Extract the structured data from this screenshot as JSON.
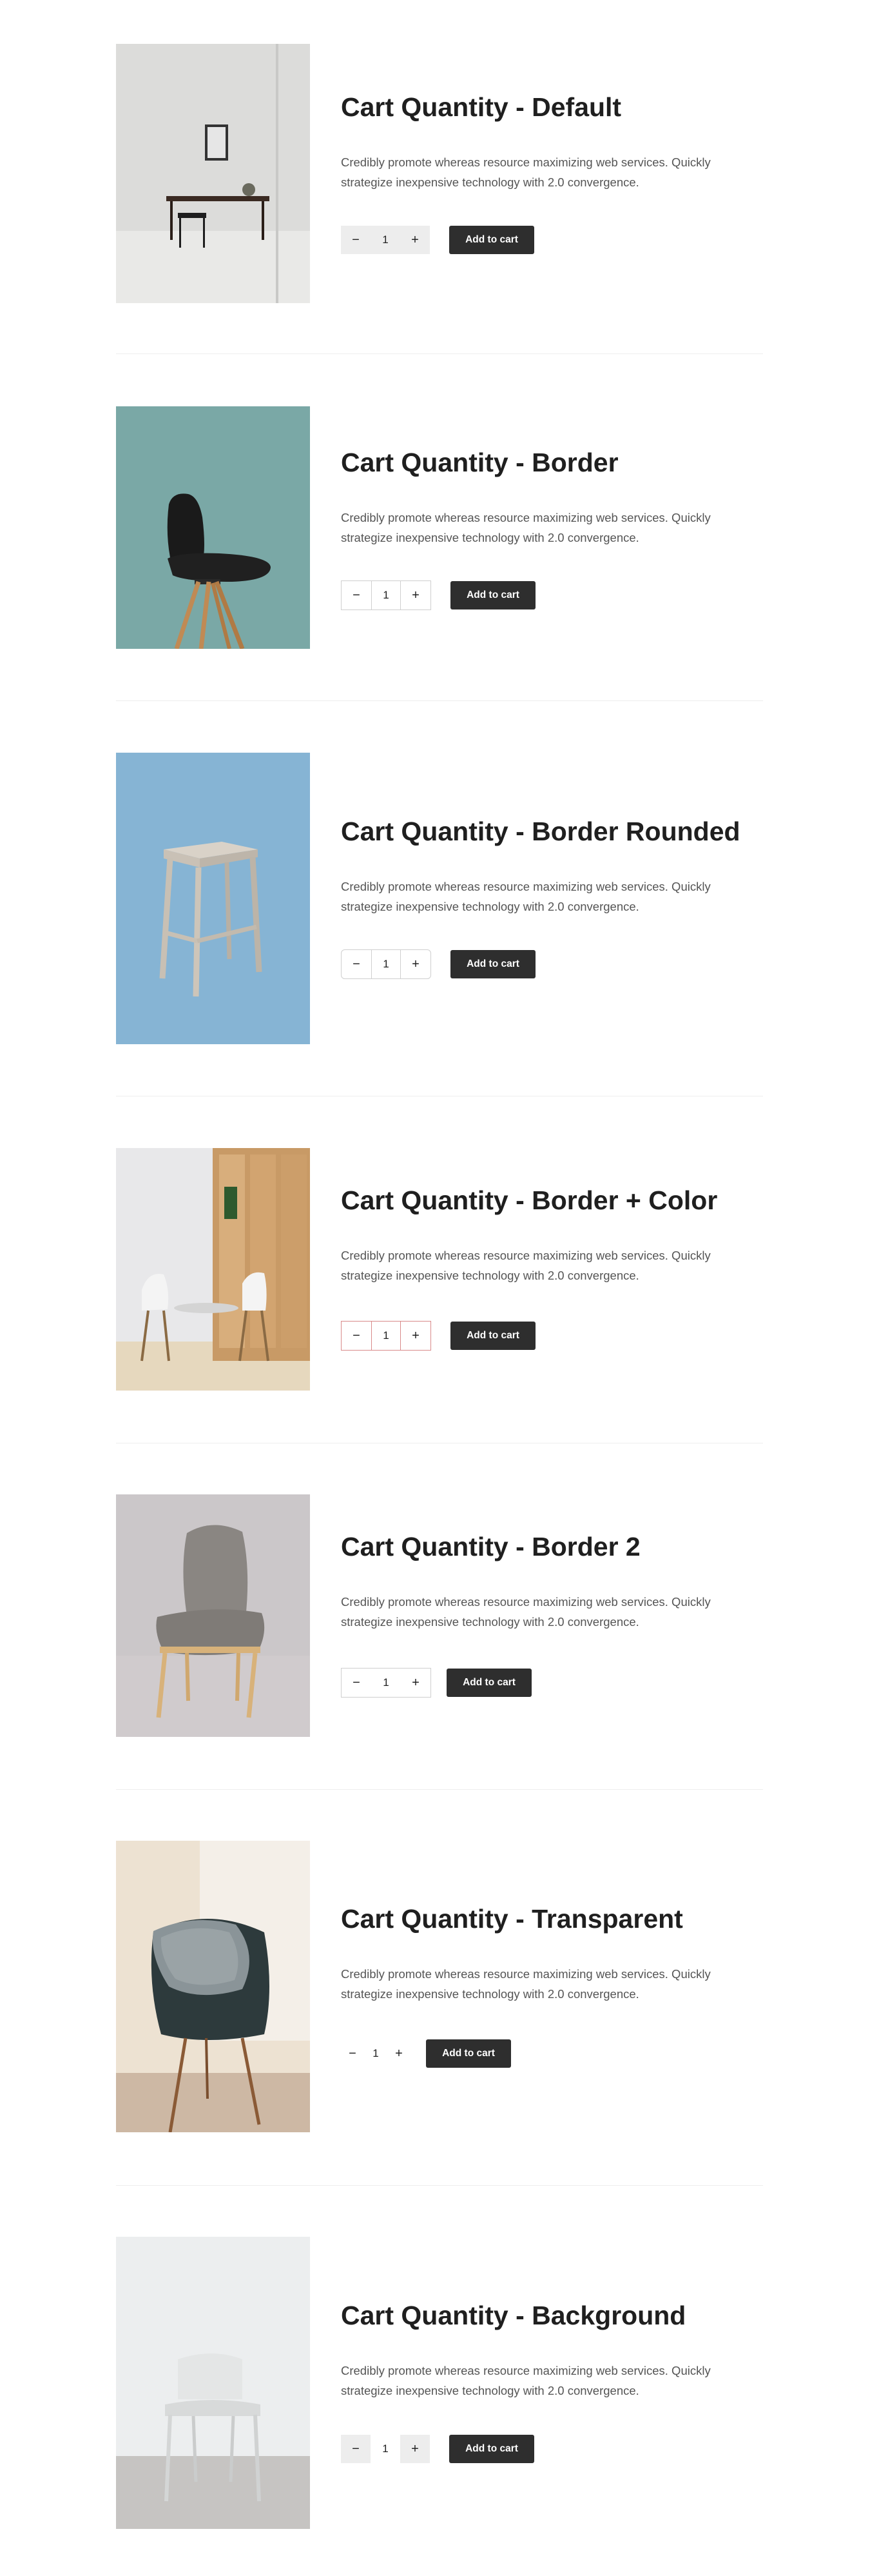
{
  "sections": [
    {
      "title": "Cart Quantity - Default",
      "description": "Credibly promote whereas resource maximizing web services. Quickly strategize inexpensive technology with 2.0 convergence.",
      "quantity": "1",
      "minus": "−",
      "plus": "+",
      "cart_label": "Add to cart",
      "image": "wall-mirror-desk-chair"
    },
    {
      "title": "Cart Quantity - Border",
      "description": "Credibly promote whereas resource maximizing web services. Quickly strategize inexpensive technology with 2.0 convergence.",
      "quantity": "1",
      "minus": "−",
      "plus": "+",
      "cart_label": "Add to cart",
      "image": "black-shell-chair-teal"
    },
    {
      "title": "Cart Quantity - Border Rounded",
      "description": "Credibly promote whereas resource maximizing web services. Quickly strategize inexpensive technology with 2.0 convergence.",
      "quantity": "1",
      "minus": "−",
      "plus": "+",
      "cart_label": "Add to cart",
      "image": "wooden-stool-blue"
    },
    {
      "title": "Cart Quantity - Border + Color",
      "description": "Credibly promote whereas resource maximizing web services. Quickly strategize inexpensive technology with 2.0 convergence.",
      "quantity": "1",
      "minus": "−",
      "plus": "+",
      "cart_label": "Add to cart",
      "image": "dining-room-white-chairs"
    },
    {
      "title": "Cart Quantity - Border 2",
      "description": "Credibly promote whereas resource maximizing web services. Quickly strategize inexpensive technology with 2.0 convergence.",
      "quantity": "1",
      "minus": "−",
      "plus": "+",
      "cart_label": "Add to cart",
      "image": "grey-upholstered-chair"
    },
    {
      "title": "Cart Quantity - Transparent",
      "description": "Credibly promote whereas resource maximizing web services. Quickly strategize inexpensive technology with 2.0 convergence.",
      "quantity": "1",
      "minus": "−",
      "plus": "+",
      "cart_label": "Add to cart",
      "image": "armchair-with-pillow"
    },
    {
      "title": "Cart Quantity - Background",
      "description": "Credibly promote whereas resource maximizing web services. Quickly strategize inexpensive technology with 2.0 convergence.",
      "quantity": "1",
      "minus": "−",
      "plus": "+",
      "cart_label": "Add to cart",
      "image": "white-plastic-chair"
    }
  ],
  "colors": {
    "button_dark": "#2e2e2e",
    "accent_border": "#d98a8a",
    "text_body": "#555555",
    "divider": "#eeeeee"
  }
}
